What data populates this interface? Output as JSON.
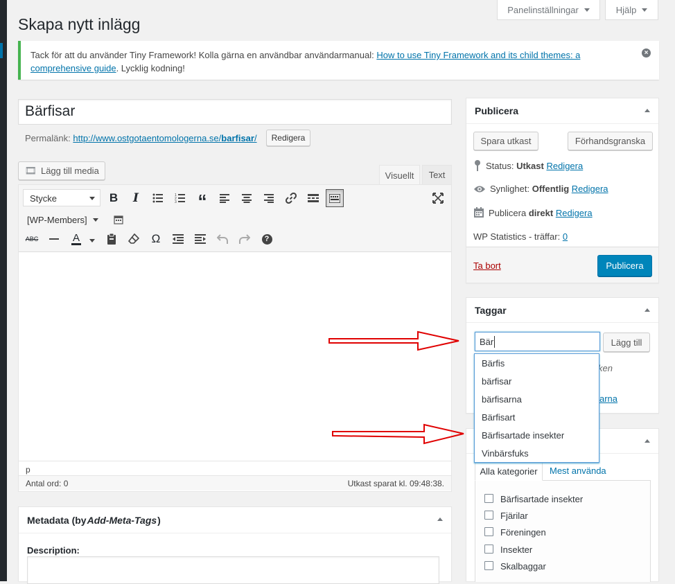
{
  "page": {
    "title": "Skapa nytt inlägg"
  },
  "screen_options": {
    "panel_label": "Panelinställningar",
    "help_label": "Hjälp"
  },
  "notice": {
    "text_before": "Tack för att du använder Tiny Framework! Kolla gärna en användbar användarmanual: ",
    "link_line1": "How to use Tiny Framework and its child themes: a",
    "link_line2": "comprehensive guide",
    "text_after": ". Lycklig kodning!"
  },
  "post": {
    "title_value": "Bärfisar",
    "permalink_label": "Permalänk:",
    "permalink_base": "http://www.ostgotaentomologerna.se/",
    "permalink_slug": "barfisar",
    "permalink_end": "/",
    "edit_label": "Redigera"
  },
  "editor": {
    "add_media_label": "Lägg till media",
    "tab_visual": "Visuellt",
    "tab_text": "Text",
    "format_select": "Stycke",
    "members_select": "[WP-Members]",
    "path": "p",
    "word_count": "Antal ord: 0",
    "draft_saved": "Utkast sparat kl. 09:48:38."
  },
  "metadata": {
    "title_prefix": "Metadata (by ",
    "title_em": "Add-Meta-Tags",
    "title_suffix": ")",
    "description_label": "Description:"
  },
  "publish": {
    "title": "Publicera",
    "save_draft": "Spara utkast",
    "preview": "Förhandsgranska",
    "status_label": "Status: ",
    "status_value": "Utkast",
    "visibility_label": "Synlighet: ",
    "visibility_value": "Offentlig",
    "publish_label": "Publicera ",
    "publish_value": "direkt",
    "edit": "Redigera",
    "stats_label": "WP Statistics - träffar: ",
    "stats_value": "0",
    "trash": "Ta bort",
    "publish_button": "Publicera"
  },
  "tags": {
    "title": "Taggar",
    "input_value": "Bär",
    "add_label": "Lägg till",
    "hint_fragment": "ken",
    "link_fragment": "arna",
    "suggestions": [
      "Bärfis",
      "bärfisar",
      "bärfisarna",
      "Bärfisart",
      "Bärfisartade insekter",
      "Vinbärsfuks"
    ]
  },
  "categories": {
    "tab_all": "Alla kategorier",
    "tab_most_used": "Mest använda",
    "items": [
      "Bärfisartade insekter",
      "Fjärilar",
      "Föreningen",
      "Insekter",
      "Skalbaggar"
    ]
  },
  "colors": {
    "accent": "#0085ba",
    "notice_border": "#46b450",
    "arrow": "#e00000",
    "link": "#0073aa",
    "trash": "#a00"
  }
}
